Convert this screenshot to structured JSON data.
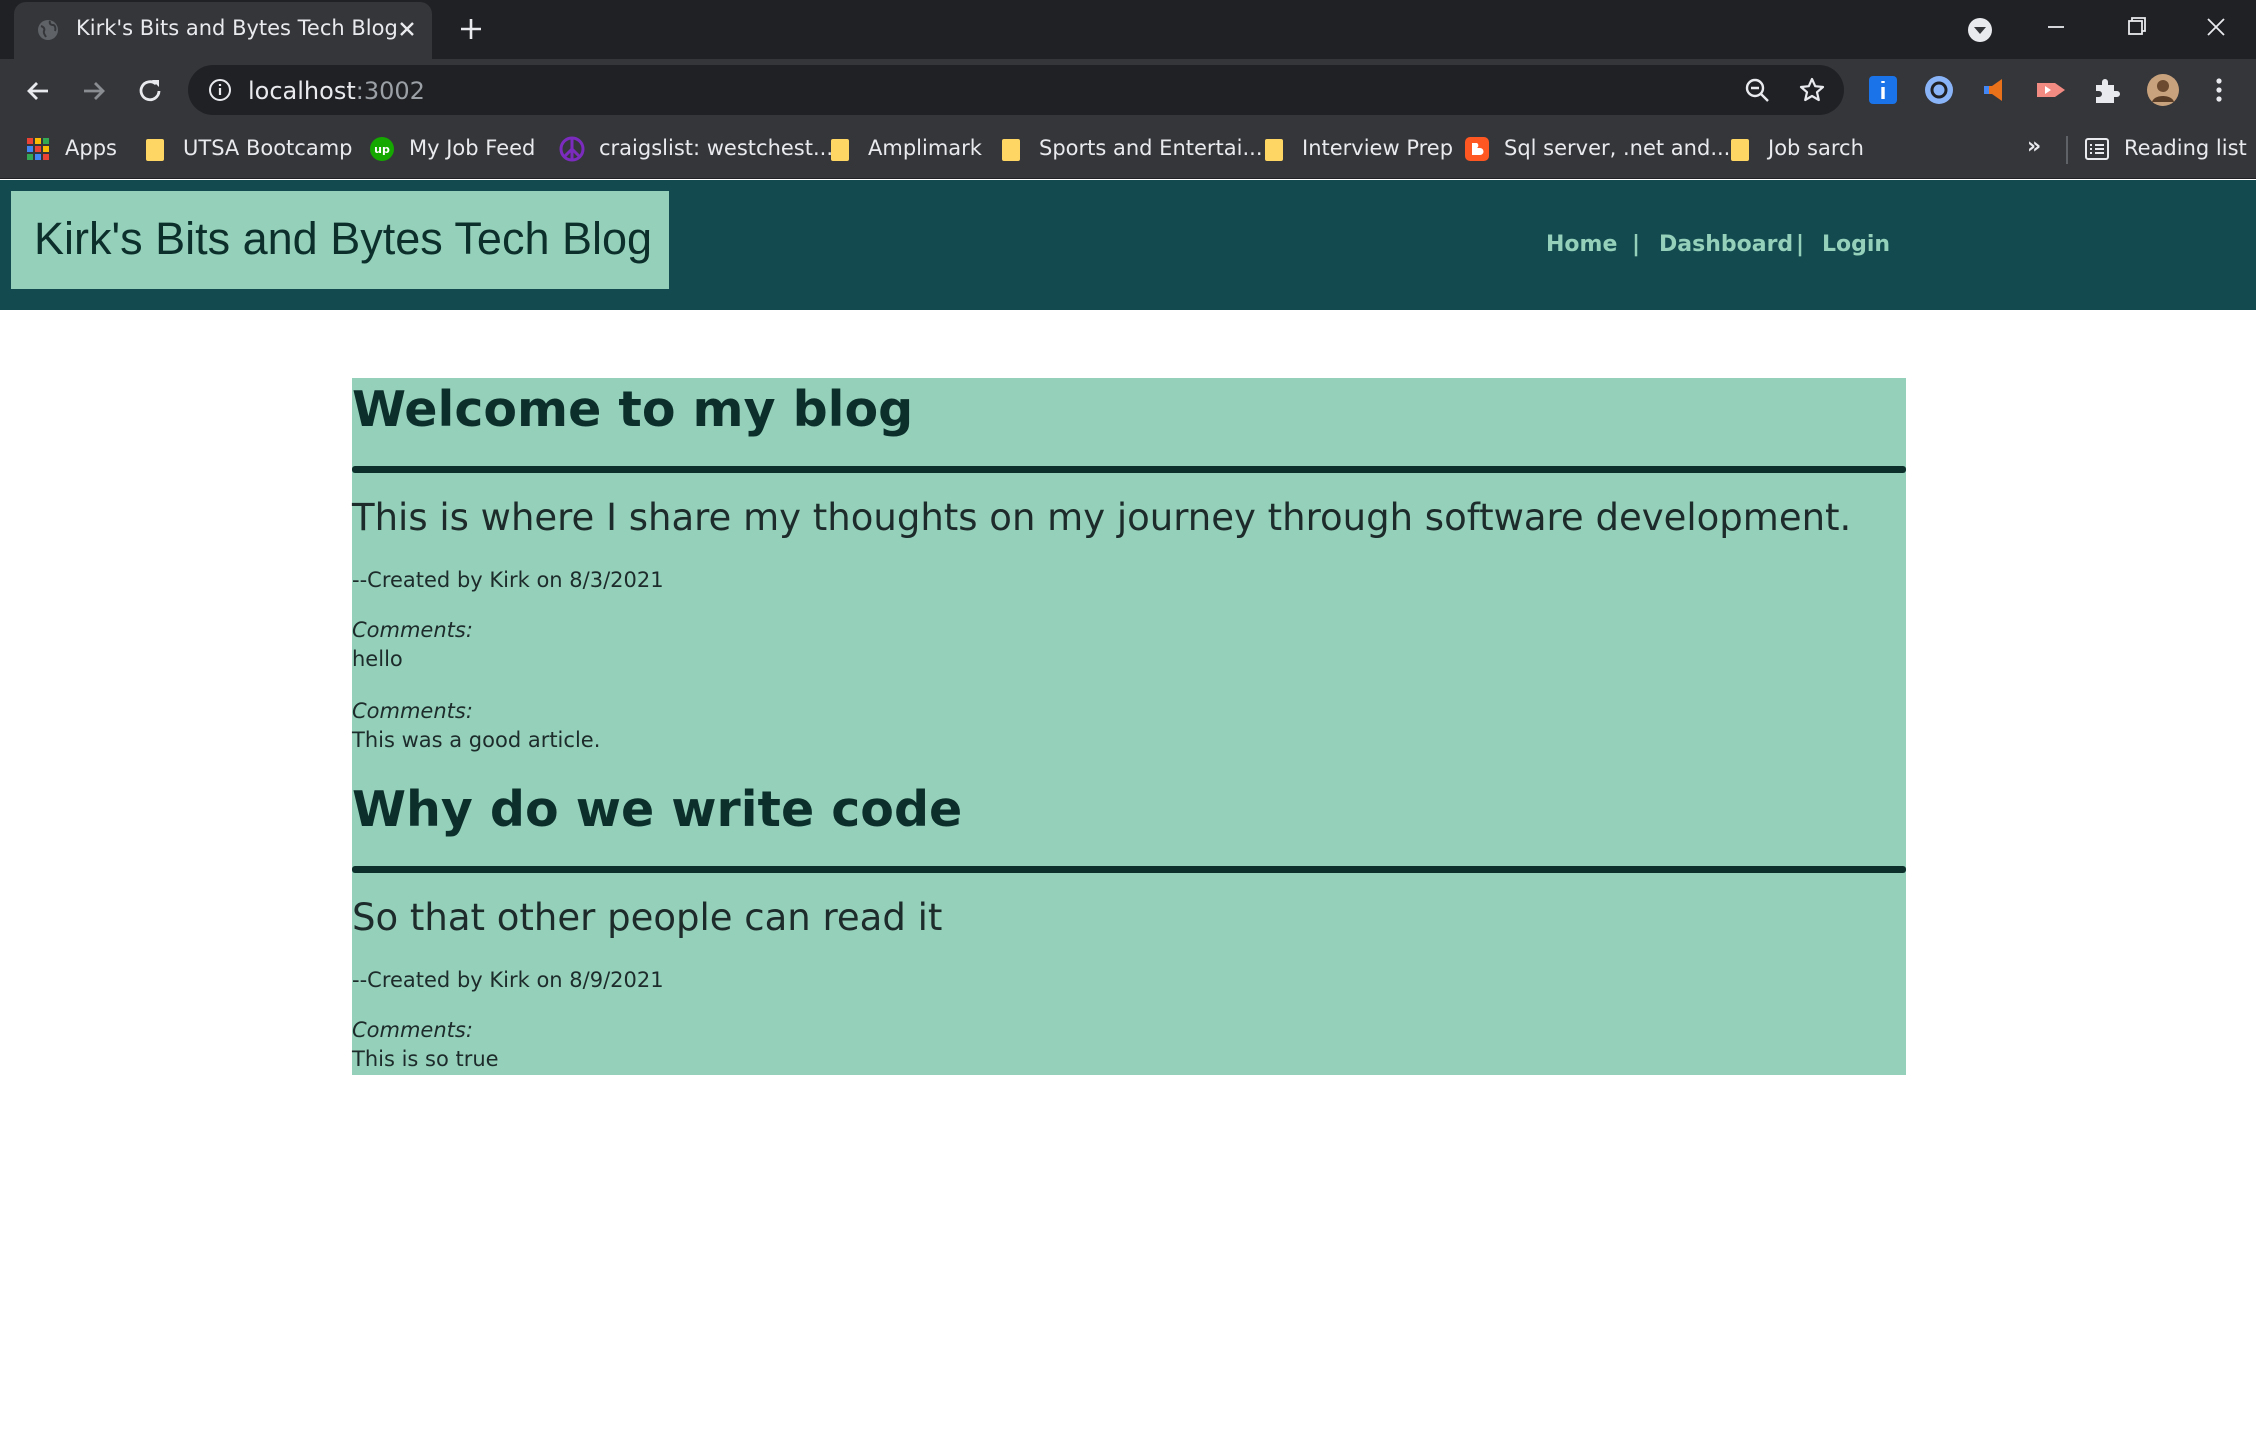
{
  "browser": {
    "tab_title": "Kirk's Bits and Bytes Tech Blog",
    "url_host": "localhost",
    "url_port": ":3002",
    "bookmarks": [
      {
        "label": "Apps",
        "icon": "apps-grid-icon"
      },
      {
        "label": "UTSA Bootcamp",
        "icon": "folder-icon"
      },
      {
        "label": "My Job Feed",
        "icon": "upwork-icon"
      },
      {
        "label": "craigslist: westchest...",
        "icon": "peace-icon"
      },
      {
        "label": "Amplimark",
        "icon": "folder-icon"
      },
      {
        "label": "Sports and Entertai...",
        "icon": "folder-icon"
      },
      {
        "label": "Interview Prep",
        "icon": "folder-icon"
      },
      {
        "label": "Sql server, .net and...",
        "icon": "blogger-icon"
      },
      {
        "label": "Job sarch",
        "icon": "folder-icon"
      }
    ],
    "more_bookmarks": "»",
    "reading_list": "Reading list",
    "colors": {
      "frame": "#202124",
      "toolbar": "#35363a",
      "text": "#e8eaed"
    }
  },
  "site": {
    "title": "Kirk's Bits and Bytes Tech Blog",
    "nav": {
      "home": "Home",
      "sep": "|",
      "dashboard": "Dashboard",
      "login": "Login"
    },
    "colors": {
      "header": "#134a4f",
      "accent": "#94d0ba",
      "ink": "#0c2f2b"
    }
  },
  "posts": [
    {
      "title": "Welcome to my blog",
      "body": "This is where I share my thoughts on my journey through software development.",
      "meta": "--Created by Kirk on 8/3/2021",
      "comments": [
        {
          "label": "Comments:",
          "text": "hello"
        },
        {
          "label": "Comments:",
          "text": "This was a good article."
        }
      ]
    },
    {
      "title": "Why do we write code",
      "body": "So that other people can read it",
      "meta": "--Created by Kirk on 8/9/2021",
      "comments": [
        {
          "label": "Comments:",
          "text": "This is so true"
        }
      ]
    }
  ]
}
